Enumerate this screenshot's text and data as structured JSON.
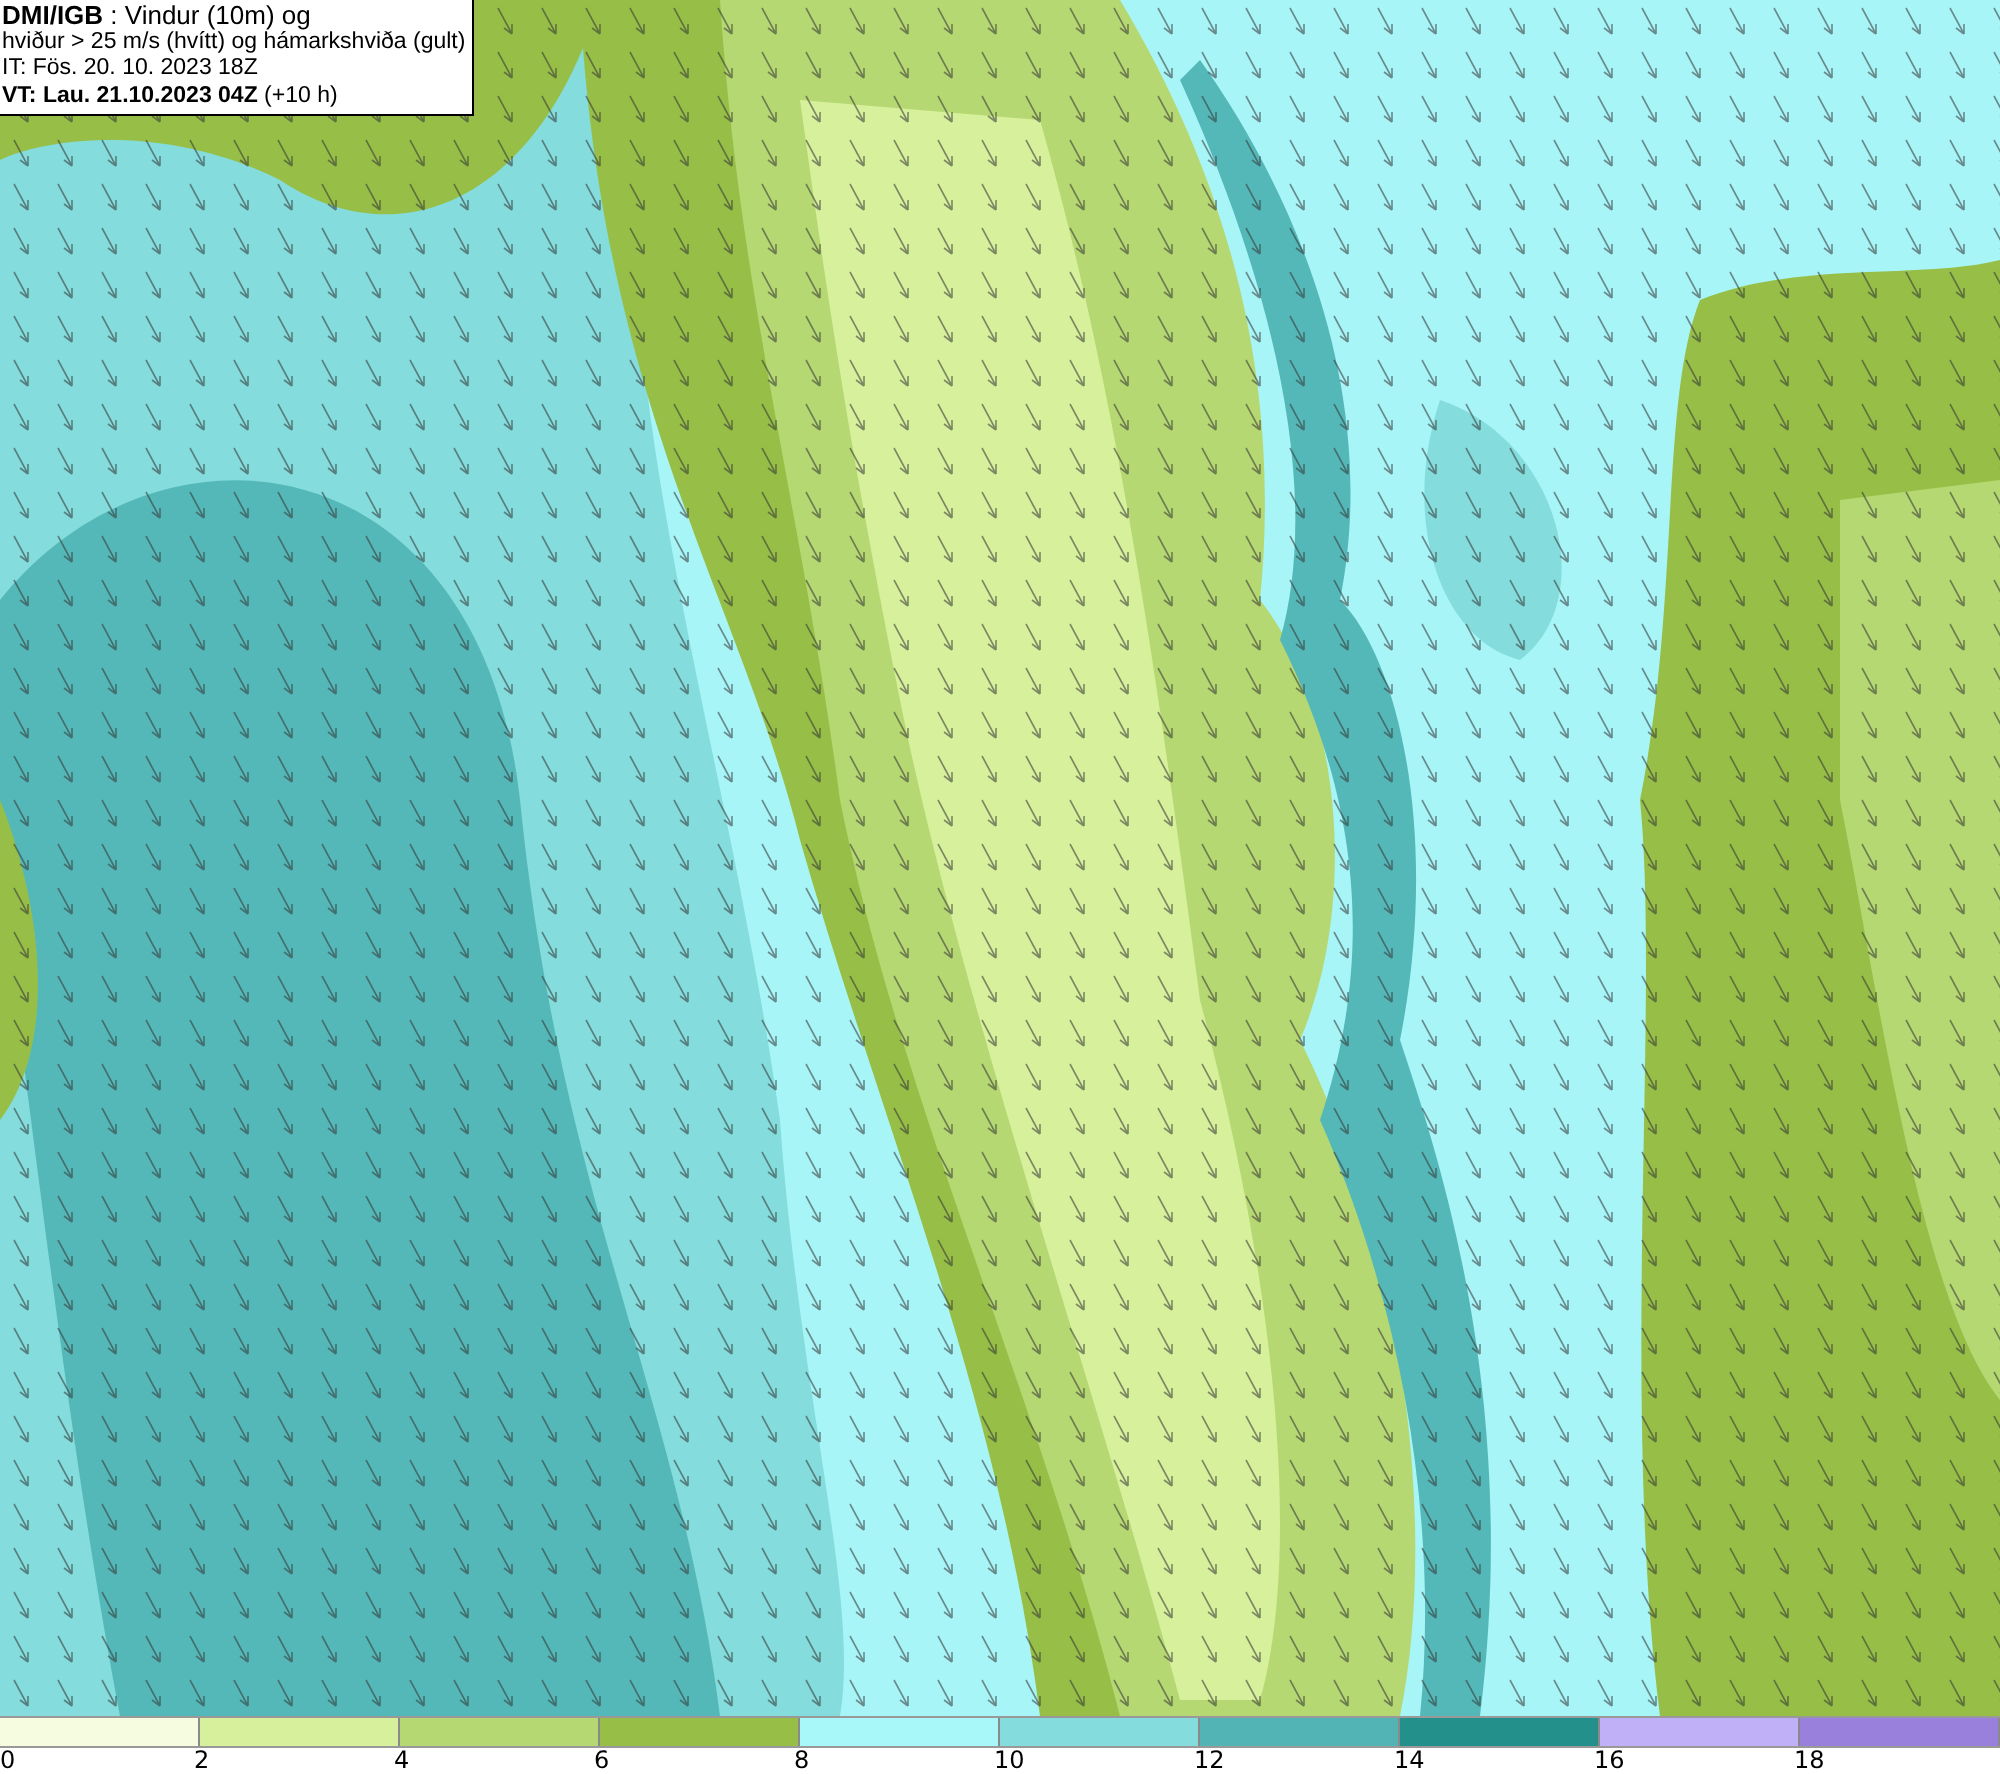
{
  "title_box": {
    "lines": [
      "**DMI/IGB** : Vindur (10m) og",
      "hviður > 25 m/s (hvítt) og hámarkshviða (gult)",
      "IT: Fös. 20. 10. 2023 18Z",
      "**VT: Lau. 21.10.2023 04Z** (+10 h)"
    ]
  },
  "legend": {
    "bins": [
      {
        "label": "0",
        "color": "#f5fce0"
      },
      {
        "label": "2",
        "color": "#d7f09c"
      },
      {
        "label": "4",
        "color": "#b6d872"
      },
      {
        "label": "6",
        "color": "#97bf47"
      },
      {
        "label": "8",
        "color": "#a8f8fa"
      },
      {
        "label": "10",
        "color": "#84dcdc"
      },
      {
        "label": "12",
        "color": "#52b4b4"
      },
      {
        "label": "14",
        "color": "#24908c"
      },
      {
        "label": "16",
        "color": "#c0b0f8"
      },
      {
        "label": "18",
        "color": "#9880dc"
      }
    ]
  }
}
